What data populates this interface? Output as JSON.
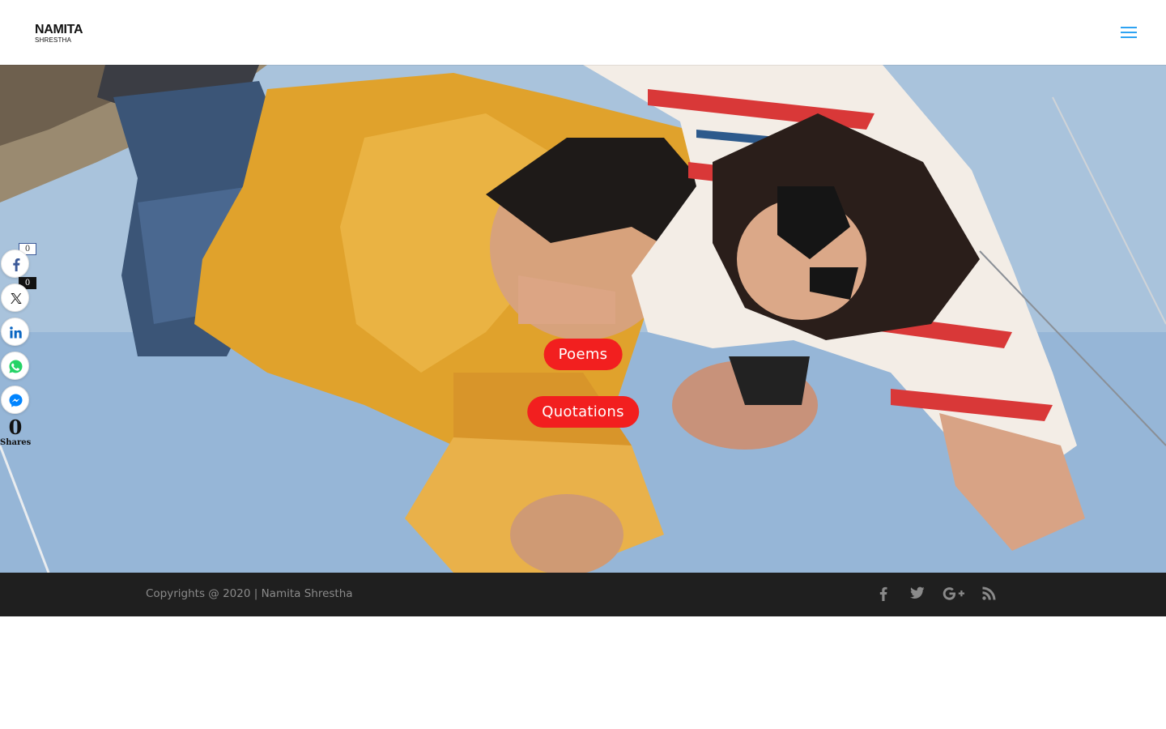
{
  "header": {
    "logo_main": "NAMITA",
    "logo_sub": "SHRESTHA",
    "menu_icon": "hamburger-menu-icon",
    "accent_color": "#2ea3f2"
  },
  "hero": {
    "buttons": [
      {
        "label": "Poems"
      },
      {
        "label": "Quotations"
      }
    ],
    "button_color": "#f21f1f"
  },
  "social": {
    "facebook": {
      "icon": "facebook-icon",
      "count": "0"
    },
    "x": {
      "icon": "x-icon",
      "count": "0"
    },
    "linkedin": {
      "icon": "linkedin-icon"
    },
    "whatsapp": {
      "icon": "whatsapp-icon"
    },
    "messenger": {
      "icon": "messenger-icon"
    },
    "total": "0",
    "total_label": "Shares"
  },
  "footer": {
    "copyright": "Copyrights @ 2020 | Namita Shrestha",
    "icons": [
      "facebook-icon",
      "twitter-icon",
      "google-plus-icon",
      "rss-icon"
    ],
    "background": "#1f1f1f",
    "text_color": "#8a8a8a"
  }
}
